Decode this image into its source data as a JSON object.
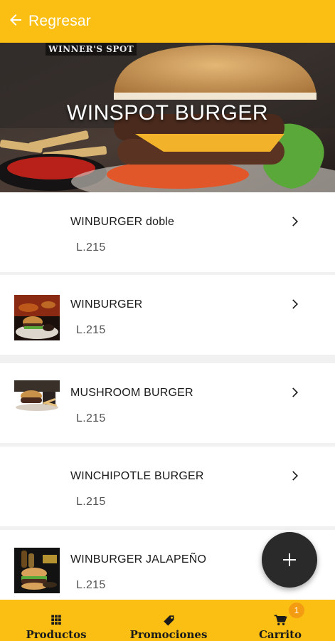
{
  "header": {
    "back_label": "Regresar"
  },
  "banner": {
    "logo_text": "WINNER'S SPOT",
    "title": "WINSPOT BURGER"
  },
  "products": [
    {
      "name": "WINBURGER doble",
      "price": "L.215",
      "has_image": false
    },
    {
      "name": "WINBURGER",
      "price": "L.215",
      "has_image": true
    },
    {
      "name": "MUSHROOM BURGER",
      "price": "L.215",
      "has_image": true
    },
    {
      "name": "WINCHIPOTLE BURGER",
      "price": "L.215",
      "has_image": false
    },
    {
      "name": "WINBURGER JALAPEÑO",
      "price": "L.215",
      "has_image": true
    }
  ],
  "fab": {
    "icon": "plus-icon"
  },
  "bottom_nav": {
    "items": [
      {
        "label": "Productos",
        "icon": "grid-icon"
      },
      {
        "label": "Promociones",
        "icon": "tag-icon"
      },
      {
        "label": "Carrito",
        "icon": "cart-icon"
      }
    ],
    "cart_badge": "1"
  },
  "colors": {
    "accent": "#fbbf13",
    "badge": "#f39c12",
    "fab": "#2a2a2a"
  }
}
